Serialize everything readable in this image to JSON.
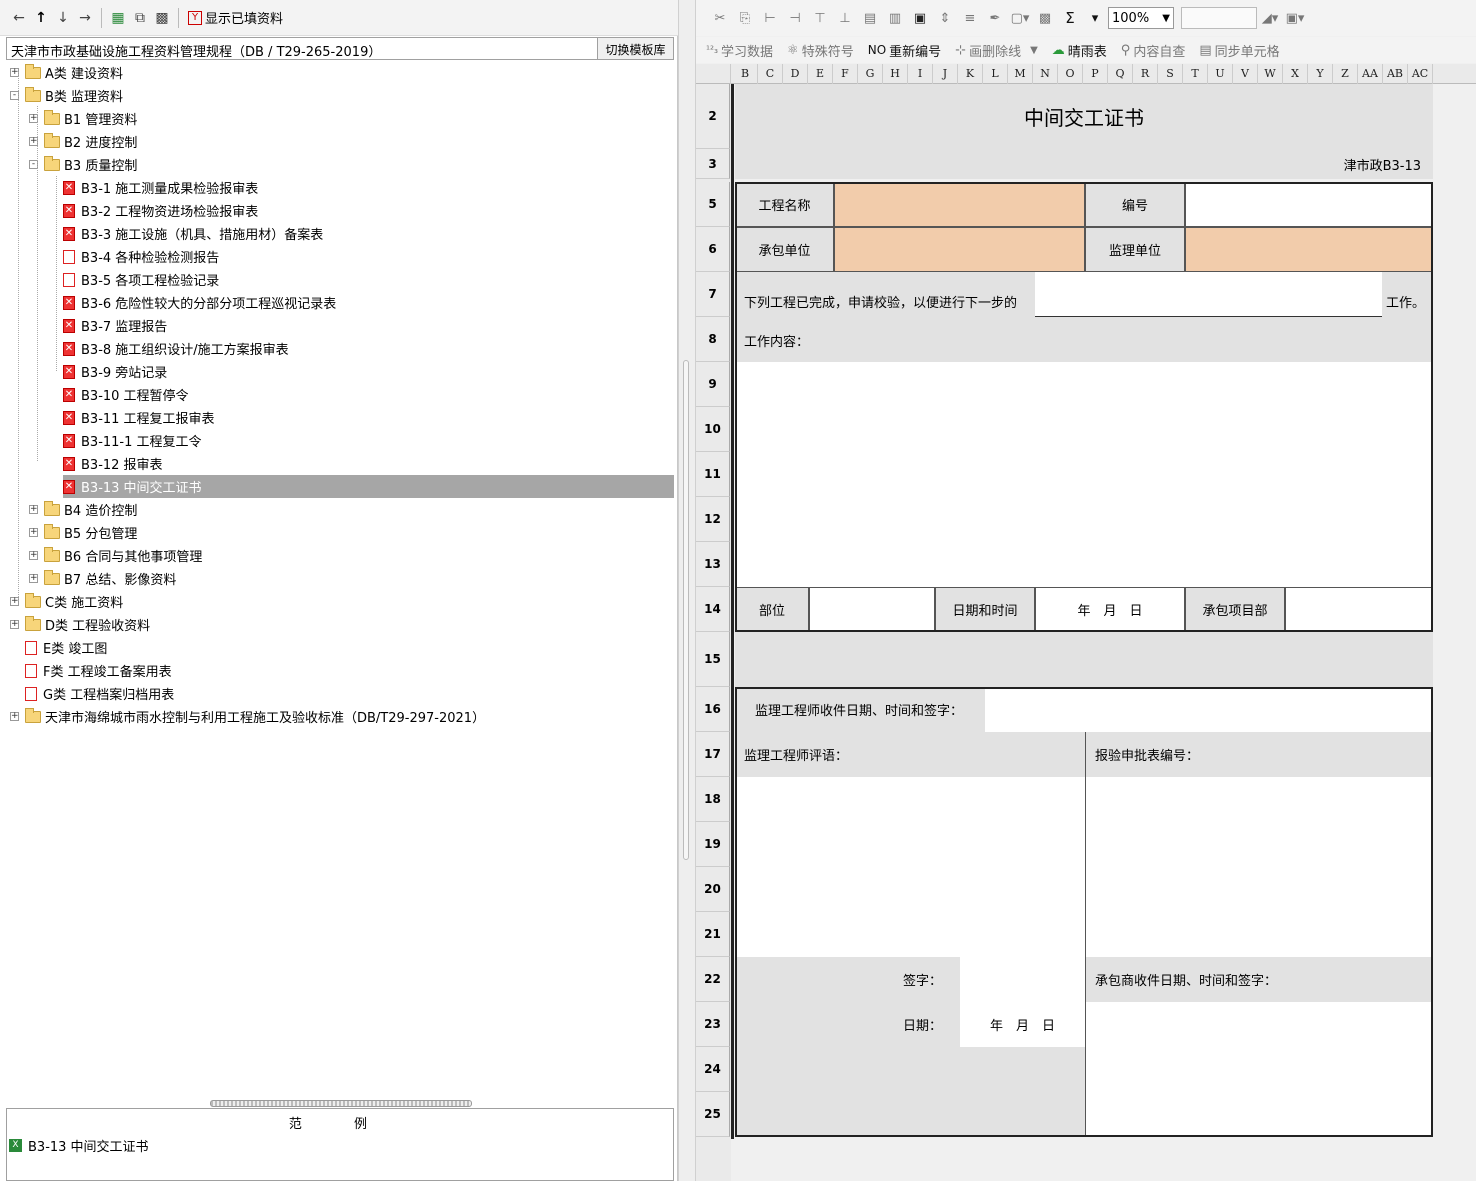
{
  "left_toolbar": {
    "back_icon": "arrow-left-icon",
    "up_icon": "arrow-up-icon",
    "down_icon": "arrow-down-icon",
    "forward_icon": "arrow-right-icon",
    "show_filled_label": "显示已填资料"
  },
  "path": {
    "text": "天津市市政基础设施工程资料管理规程（DB / T29-265-2019）",
    "switch_label": "切换模板库"
  },
  "tree": [
    {
      "label": "A类 建设资料",
      "type": "folder",
      "level": 0,
      "expander": "+"
    },
    {
      "label": "B类 监理资料",
      "type": "folder-open",
      "level": 0,
      "expander": "-"
    },
    {
      "label": "B1 管理资料",
      "type": "folder",
      "level": 1,
      "expander": "+"
    },
    {
      "label": "B2 进度控制",
      "type": "folder",
      "level": 1,
      "expander": "+"
    },
    {
      "label": "B3 质量控制",
      "type": "folder-open",
      "level": 1,
      "expander": "-"
    },
    {
      "label": "B3-1 施工测量成果检验报审表",
      "type": "xdoc",
      "level": 2
    },
    {
      "label": "B3-2 工程物资进场检验报审表",
      "type": "xdoc",
      "level": 2
    },
    {
      "label": "B3-3 施工设施（机具、措施用材）备案表",
      "type": "xdoc",
      "level": 2
    },
    {
      "label": "B3-4 各种检验检测报告",
      "type": "doc",
      "level": 2
    },
    {
      "label": "B3-5 各项工程检验记录",
      "type": "doc",
      "level": 2
    },
    {
      "label": "B3-6 危险性较大的分部分项工程巡视记录表",
      "type": "xdoc",
      "level": 2
    },
    {
      "label": "B3-7 监理报告",
      "type": "xdoc",
      "level": 2
    },
    {
      "label": "B3-8 施工组织设计/施工方案报审表",
      "type": "xdoc",
      "level": 2
    },
    {
      "label": "B3-9 旁站记录",
      "type": "xdoc",
      "level": 2
    },
    {
      "label": "B3-10 工程暂停令",
      "type": "xdoc",
      "level": 2
    },
    {
      "label": "B3-11 工程复工报审表",
      "type": "xdoc",
      "level": 2
    },
    {
      "label": "B3-11-1 工程复工令",
      "type": "xdoc",
      "level": 2
    },
    {
      "label": "B3-12 报审表",
      "type": "xdoc",
      "level": 2
    },
    {
      "label": "B3-13 中间交工证书",
      "type": "xdoc",
      "level": 2,
      "selected": true
    },
    {
      "label": "B4 造价控制",
      "type": "folder",
      "level": 1,
      "expander": "+"
    },
    {
      "label": "B5 分包管理",
      "type": "folder",
      "level": 1,
      "expander": "+"
    },
    {
      "label": "B6 合同与其他事项管理",
      "type": "folder",
      "level": 1,
      "expander": "+"
    },
    {
      "label": "B7 总结、影像资料",
      "type": "folder",
      "level": 1,
      "expander": "+"
    },
    {
      "label": "C类 施工资料",
      "type": "folder",
      "level": 0,
      "expander": "+"
    },
    {
      "label": "D类 工程验收资料",
      "type": "folder",
      "level": 0,
      "expander": "+"
    },
    {
      "label": "E类 竣工图",
      "type": "doc",
      "level": 0
    },
    {
      "label": "F类 工程竣工备案用表",
      "type": "doc",
      "level": 0
    },
    {
      "label": "G类 工程档案归档用表",
      "type": "doc",
      "level": 0
    },
    {
      "label": "天津市海绵城市雨水控制与利用工程施工及验收标准（DB/T29-297-2021）",
      "type": "folder",
      "level": 0,
      "expander": "+"
    }
  ],
  "legend": {
    "title": "范 例",
    "item": "B3-13 中间交工证书"
  },
  "right_toolbar": {
    "zoom": "100%",
    "sigma": "Σ",
    "items": [
      "学习数据",
      "特殊符号",
      "重新编号",
      "画删除线",
      "晴雨表",
      "内容自查",
      "同步单元格"
    ],
    "learn_prefix": "¹²₃",
    "renumber_prefix": "NO"
  },
  "columns": [
    "B",
    "C",
    "D",
    "E",
    "F",
    "G",
    "H",
    "I",
    "J",
    "K",
    "L",
    "M",
    "N",
    "O",
    "P",
    "Q",
    "R",
    "S",
    "T",
    "U",
    "V",
    "W",
    "X",
    "Y",
    "Z",
    "AA",
    "AB",
    "AC"
  ],
  "rows": [
    "2",
    "3",
    "5",
    "6",
    "7",
    "8",
    "9",
    "10",
    "11",
    "12",
    "13",
    "14",
    "15",
    "16",
    "17",
    "18",
    "19",
    "20",
    "21",
    "22",
    "23",
    "24",
    "25"
  ],
  "form": {
    "title": "中间交工证书",
    "code": "津市政B3-13",
    "project_name_label": "工程名称",
    "number_label": "编号",
    "contractor_label": "承包单位",
    "supervisor_label": "监理单位",
    "completed_text": "下列工程已完成，申请校验，以便进行下一步的",
    "work_suffix": "工作。",
    "work_content_label": "工作内容：",
    "location_label": "部位",
    "datetime_label": "日期和时间",
    "date_ymd": "年　月　日",
    "contract_dept_label": "承包项目部",
    "engineer_receipt_label": "监理工程师收件日期、时间和签字：",
    "engineer_comment_label": "监理工程师评语：",
    "approval_number_label": "报验申批表编号：",
    "signature_label": "签字：",
    "date_label": "日期：",
    "contractor_receipt_label": "承包商收件日期、时间和签字："
  }
}
